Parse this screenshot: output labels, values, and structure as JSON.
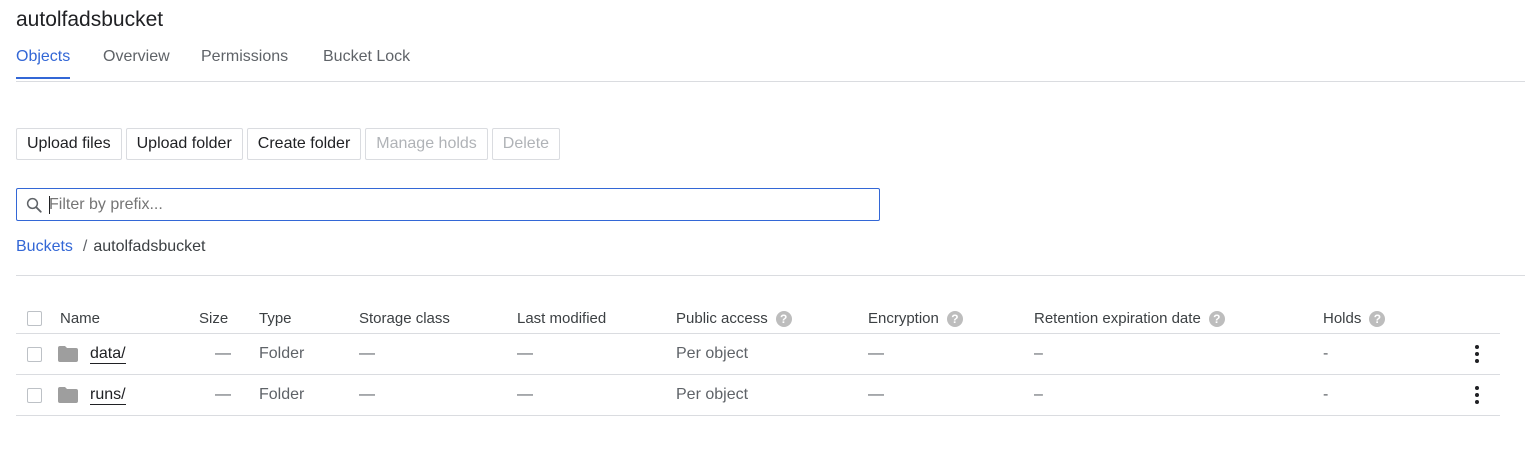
{
  "bucket": {
    "title": "autolfadsbucket"
  },
  "tabs": [
    {
      "label": "Objects",
      "active": true
    },
    {
      "label": "Overview"
    },
    {
      "label": "Permissions"
    },
    {
      "label": "Bucket Lock"
    }
  ],
  "actions": {
    "upload_files": "Upload files",
    "upload_folder": "Upload folder",
    "create_folder": "Create folder",
    "manage_holds": "Manage holds",
    "delete": "Delete"
  },
  "filter": {
    "placeholder": "Filter by prefix...",
    "value": ""
  },
  "breadcrumb": {
    "root": "Buckets",
    "separator": "/",
    "current": "autolfadsbucket"
  },
  "table": {
    "columns": {
      "name": "Name",
      "size": "Size",
      "type": "Type",
      "storage_class": "Storage class",
      "last_modified": "Last modified",
      "public_access": "Public access",
      "encryption": "Encryption",
      "retention": "Retention expiration date",
      "holds": "Holds"
    },
    "help_glyph": "?",
    "rows": [
      {
        "name": "data/",
        "size": "—",
        "type": "Folder",
        "storage_class": "—",
        "last_modified": "—",
        "public_access": "Per object",
        "encryption": "—",
        "retention": "–",
        "holds": "-"
      },
      {
        "name": "runs/",
        "size": "—",
        "type": "Folder",
        "storage_class": "—",
        "last_modified": "—",
        "public_access": "Per object",
        "encryption": "—",
        "retention": "–",
        "holds": "-"
      }
    ]
  },
  "colors": {
    "accent": "#3367d6",
    "border": "#dadce0",
    "muted": "#5f6368",
    "folder": "#9e9e9e"
  },
  "icons": {
    "search": "search-icon",
    "folder": "folder-icon",
    "help": "help-icon",
    "more": "more-vert-icon"
  }
}
